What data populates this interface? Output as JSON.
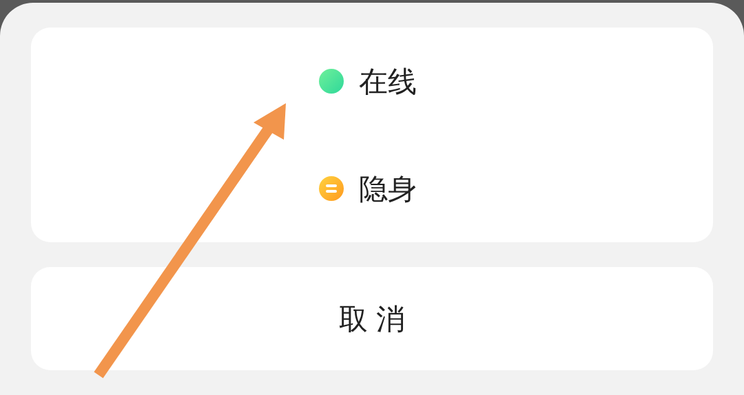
{
  "status_options": [
    {
      "kind": "online",
      "label": "在线"
    },
    {
      "kind": "invisible",
      "label": "隐身"
    }
  ],
  "cancel_button": "取 消",
  "annotation": {
    "kind": "arrow"
  }
}
